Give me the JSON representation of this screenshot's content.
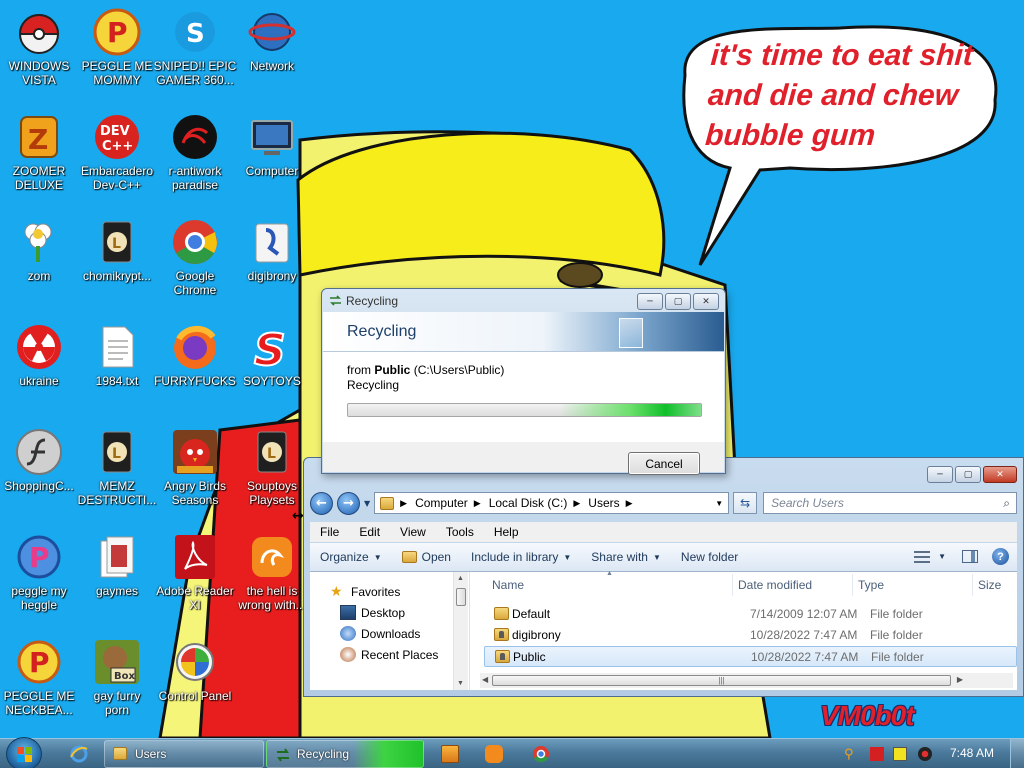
{
  "bubble": {
    "line1": "it's time to eat shit",
    "line2": "and die and chew",
    "line3": "bubble gum"
  },
  "signature": "VM0b0t",
  "desktop_icons": [
    {
      "label": "WINDOWS\nVISTA",
      "icon": "pokeball-icon"
    },
    {
      "label": "PEGGLE ME\nMOMMY",
      "icon": "peggle-icon"
    },
    {
      "label": "SNIPED!! EPIC\nGAMER 360...",
      "icon": "skype-icon"
    },
    {
      "label": "Network",
      "icon": "network-icon"
    },
    {
      "label": "ZOOMER\nDELUXE",
      "icon": "zuma-icon"
    },
    {
      "label": "Embarcadero\nDev-C++",
      "icon": "devcpp-icon"
    },
    {
      "label": "r-antiwork\nparadise",
      "icon": "red-swirl-icon"
    },
    {
      "label": "Computer",
      "icon": "computer-icon"
    },
    {
      "label": "zom",
      "icon": "flower-icon"
    },
    {
      "label": "chomikrypt...",
      "icon": "shortcut-icon"
    },
    {
      "label": "Google\nChrome",
      "icon": "chrome-icon"
    },
    {
      "label": "digibrony",
      "icon": "user-folder-icon"
    },
    {
      "label": "ukraine",
      "icon": "radiation-icon"
    },
    {
      "label": "1984.txt",
      "icon": "text-file-icon"
    },
    {
      "label": "FURRYFUCKS",
      "icon": "firefox-icon"
    },
    {
      "label": "SOYTOYS",
      "icon": "soytoys-icon"
    },
    {
      "label": "ShoppingC...",
      "icon": "flash-icon"
    },
    {
      "label": "MEMZ\nDESTRUCTI...",
      "icon": "shortcut-icon"
    },
    {
      "label": "Angry Birds\nSeasons",
      "icon": "angry-birds-icon"
    },
    {
      "label": "Souptoys\nPlaysets",
      "icon": "shortcut-icon"
    },
    {
      "label": "peggle my\nheggle",
      "icon": "peggle-icon"
    },
    {
      "label": "gaymes",
      "icon": "documents-icon"
    },
    {
      "label": "Adobe Reader\nXI",
      "icon": "adobe-reader-icon"
    },
    {
      "label": "the hell is\nwrong with...",
      "icon": "uc-browser-icon"
    },
    {
      "label": "PEGGLE ME\nNECKBEA...",
      "icon": "peggle-icon"
    },
    {
      "label": "gay furry\nporn",
      "icon": "gopher-box-icon"
    },
    {
      "label": "Control Panel",
      "icon": "control-panel-icon"
    }
  ],
  "recycling": {
    "title": "Recycling",
    "heading": "Recycling",
    "from_prefix": "from ",
    "from_bold": "Public",
    "from_path": " (C:\\Users\\Public)",
    "status": "Recycling",
    "progress_pct": 100,
    "cancel_label": "Cancel",
    "window_buttons": {
      "min": "─",
      "max": "▢",
      "close": "✕"
    }
  },
  "explorer": {
    "breadcrumb": [
      "Computer",
      "Local Disk (C:)",
      "Users"
    ],
    "search_placeholder": "Search Users",
    "menu": [
      "File",
      "Edit",
      "View",
      "Tools",
      "Help"
    ],
    "toolbar": {
      "organize": "Organize",
      "open": "Open",
      "include": "Include in library",
      "share": "Share with",
      "new_folder": "New folder"
    },
    "nav": {
      "favorites": "Favorites",
      "desktop": "Desktop",
      "downloads": "Downloads",
      "recent": "Recent Places"
    },
    "columns": {
      "name": "Name",
      "date": "Date modified",
      "type": "Type",
      "size": "Size"
    },
    "rows": [
      {
        "name": "Default",
        "date": "7/14/2009 12:07 AM",
        "type": "File folder"
      },
      {
        "name": "digibrony",
        "date": "10/28/2022 7:47 AM",
        "type": "File folder"
      },
      {
        "name": "Public",
        "date": "10/28/2022 7:47 AM",
        "type": "File folder"
      }
    ],
    "window_buttons": {
      "min": "─",
      "max": "▢",
      "close": "✕"
    }
  },
  "taskbar": {
    "tasks": [
      {
        "label": "Users"
      },
      {
        "label": "Recycling"
      }
    ],
    "clock": "7:48 AM"
  }
}
